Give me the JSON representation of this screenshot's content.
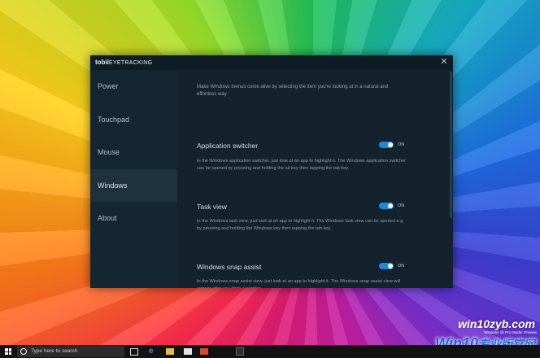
{
  "app": {
    "brand_bold": "tobii",
    "brand_light": "EYETRACKING",
    "close_glyph": "✕"
  },
  "sidebar": {
    "items": [
      {
        "label": "Power",
        "active": false
      },
      {
        "label": "Touchpad",
        "active": false
      },
      {
        "label": "Mouse",
        "active": false
      },
      {
        "label": "Windows",
        "active": true
      },
      {
        "label": "About",
        "active": false
      }
    ]
  },
  "content": {
    "intro": "Make Windows menus come alive by selecting the item you're looking at in a natural and effortless way.",
    "settings": [
      {
        "title": "Application switcher",
        "state": "ON",
        "description": "In the Windows application switcher, just look at an app to highlight it. The Windows application switcher can be opened by pressing and holding the alt key then tapping the tab key."
      },
      {
        "title": "Task view",
        "state": "ON",
        "description": "In the Windows task view, just look at an app to highlight it. The Windows task view can be opened e.g. by pressing and holding the Windows key then tapping the tab key."
      },
      {
        "title": "Windows snap assist",
        "state": "ON",
        "description": "In the Windows snap assist view, just look at an app to highlight it. The Windows snap assist view will appear after you dock a window."
      }
    ]
  },
  "taskbar": {
    "search_placeholder": "Type here to search"
  },
  "watermark": {
    "site": "win10zyb.com",
    "build": "Windows 10 Pro Insider Preview",
    "brand_latin": "Win10",
    "brand_cn": "专业版官网"
  },
  "colors": {
    "accent": "#1b8bd6",
    "window_bg": "#13222d",
    "sidebar_bg": "#142631"
  }
}
